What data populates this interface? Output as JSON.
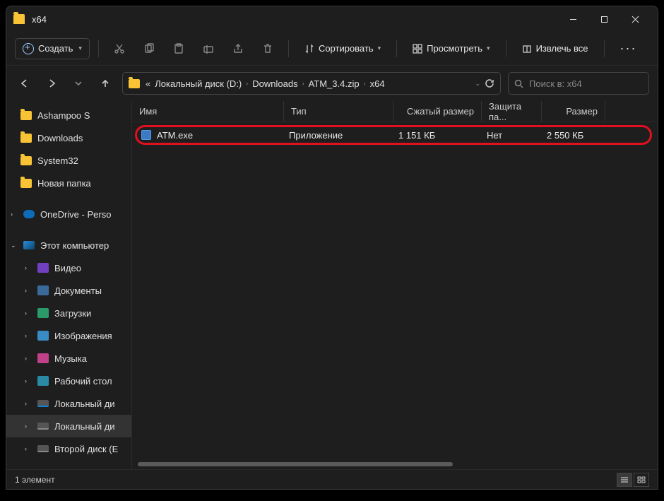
{
  "title": "x64",
  "toolbar": {
    "new_label": "Создать",
    "sort_label": "Сортировать",
    "view_label": "Просмотреть",
    "extract_label": "Извлечь все"
  },
  "breadcrumb": {
    "items": [
      "Локальный диск (D:)",
      "Downloads",
      "ATM_3.4.zip",
      "x64"
    ]
  },
  "search": {
    "placeholder": "Поиск в: x64"
  },
  "sidebar": {
    "items": [
      {
        "label": "Ashampoo S",
        "icon": "folder",
        "level": 1
      },
      {
        "label": "Downloads",
        "icon": "folder",
        "level": 1
      },
      {
        "label": "System32",
        "icon": "folder",
        "level": 1
      },
      {
        "label": "Новая папка",
        "icon": "folder",
        "level": 1
      },
      {
        "label": "OneDrive - Perso",
        "icon": "cloud",
        "level": 1,
        "expand": ">"
      },
      {
        "label": "Этот компьютер",
        "icon": "pc",
        "level": 1,
        "expand": "v"
      },
      {
        "label": "Видео",
        "icon": "sq",
        "color": "#7040c0",
        "level": 2,
        "expand": ">"
      },
      {
        "label": "Документы",
        "icon": "sq",
        "color": "#3a6a9a",
        "level": 2,
        "expand": ">"
      },
      {
        "label": "Загрузки",
        "icon": "sq",
        "color": "#2a9a6a",
        "level": 2,
        "expand": ">"
      },
      {
        "label": "Изображения",
        "icon": "sq",
        "color": "#3a8ac4",
        "level": 2,
        "expand": ">"
      },
      {
        "label": "Музыка",
        "icon": "sq",
        "color": "#c0408a",
        "level": 2,
        "expand": ">"
      },
      {
        "label": "Рабочий стол",
        "icon": "sq",
        "color": "#2a8aa4",
        "level": 2,
        "expand": ">"
      },
      {
        "label": "Локальный ди",
        "icon": "drive-win",
        "level": 2,
        "expand": ">"
      },
      {
        "label": "Локальный ди",
        "icon": "drive",
        "level": 2,
        "expand": ">",
        "active": true
      },
      {
        "label": "Второй диск (E",
        "icon": "drive",
        "level": 2,
        "expand": ">"
      }
    ]
  },
  "columns": {
    "name": "Имя",
    "type": "Тип",
    "compressed": "Сжатый размер",
    "protection": "Защита па...",
    "size": "Размер"
  },
  "files": [
    {
      "name": "ATM.exe",
      "type": "Приложение",
      "compressed": "1 151 КБ",
      "protection": "Нет",
      "size": "2 550 КБ"
    }
  ],
  "status": {
    "count_label": "1 элемент"
  }
}
